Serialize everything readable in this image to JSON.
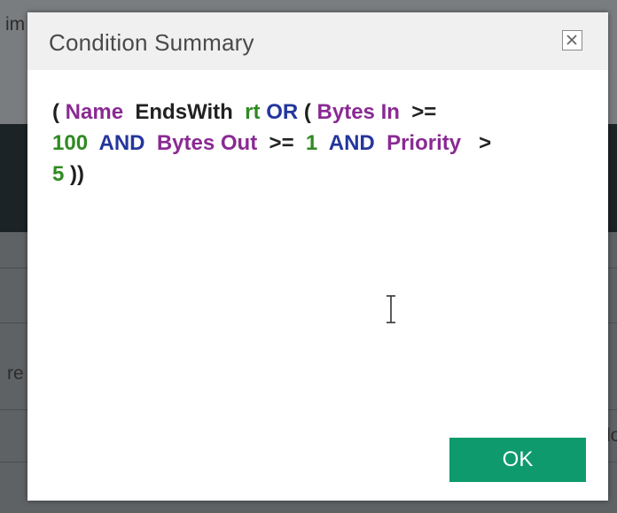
{
  "background": {
    "fragments": [
      "im",
      "re",
      "lo"
    ]
  },
  "dialog": {
    "title": "Condition Summary",
    "close_icon": "close-icon",
    "ok_label": "OK",
    "condition_tokens": [
      {
        "text": "(",
        "kind": "paren"
      },
      {
        "text": "Name",
        "kind": "field"
      },
      {
        "text": "EndsWith",
        "kind": "op"
      },
      {
        "text": "rt",
        "kind": "val"
      },
      {
        "text": "OR",
        "kind": "logic"
      },
      {
        "text": "(",
        "kind": "paren"
      },
      {
        "text": "Bytes In",
        "kind": "field"
      },
      {
        "text": ">=",
        "kind": "op"
      },
      {
        "text": "100",
        "kind": "val"
      },
      {
        "text": "AND",
        "kind": "logic"
      },
      {
        "text": "Bytes Out",
        "kind": "field"
      },
      {
        "text": ">=",
        "kind": "op"
      },
      {
        "text": "1",
        "kind": "val"
      },
      {
        "text": "AND",
        "kind": "logic"
      },
      {
        "text": "Priority",
        "kind": "field"
      },
      {
        "text": ">",
        "kind": "op"
      },
      {
        "text": "5",
        "kind": "val"
      },
      {
        "text": "))",
        "kind": "paren"
      }
    ]
  },
  "colors": {
    "field": "#8a2a93",
    "value": "#2f8a22",
    "logic": "#24369c",
    "ok_button": "#0f9a6e"
  },
  "cursor_icon": "text-cursor-icon"
}
